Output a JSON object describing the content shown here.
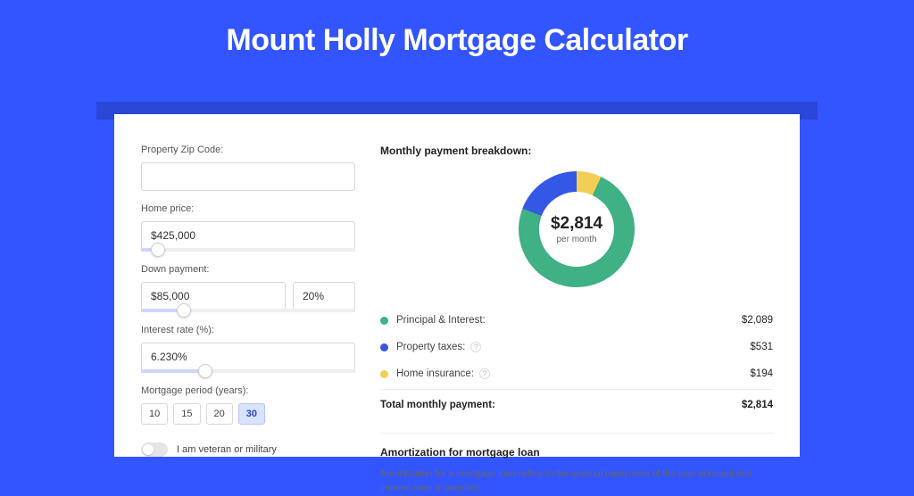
{
  "title": "Mount Holly Mortgage Calculator",
  "colors": {
    "accent": "#3355ff",
    "green": "#3fb185",
    "blue": "#3557e5",
    "yellow": "#f2cf54"
  },
  "inputs": {
    "zip": {
      "label": "Property Zip Code:",
      "value": ""
    },
    "price": {
      "label": "Home price:",
      "value": "$425,000",
      "slider_pct": 8
    },
    "down": {
      "label": "Down payment:",
      "value": "$85,000",
      "pct": "20%",
      "slider_pct": 20
    },
    "rate": {
      "label": "Interest rate (%):",
      "value": "6.230%",
      "slider_pct": 30
    },
    "period": {
      "label": "Mortgage period (years):",
      "options": [
        "10",
        "15",
        "20",
        "30"
      ],
      "selected": "30"
    },
    "veteran": {
      "label": "I am veteran or military",
      "value": false
    }
  },
  "breakdown": {
    "title": "Monthly payment breakdown:",
    "total": "$2,814",
    "sub": "per month",
    "items": [
      {
        "label": "Principal & Interest:",
        "value": "$2,089",
        "color": "green",
        "info": false
      },
      {
        "label": "Property taxes:",
        "value": "$531",
        "color": "blue",
        "info": true
      },
      {
        "label": "Home insurance:",
        "value": "$194",
        "color": "yellow",
        "info": true
      }
    ],
    "total_row": {
      "label": "Total monthly payment:",
      "value": "$2,814"
    }
  },
  "amortization": {
    "title": "Amortization for mortgage loan",
    "text": "Amortization for a mortgage loan refers to the gradual repayment of the loan principal and interest over a specified"
  },
  "chart_data": {
    "type": "pie",
    "title": "Monthly payment breakdown",
    "categories": [
      "Principal & Interest",
      "Property taxes",
      "Home insurance"
    ],
    "values": [
      2089,
      531,
      194
    ],
    "total": 2814,
    "unit": "USD per month",
    "colors": [
      "#3fb185",
      "#3557e5",
      "#f2cf54"
    ]
  }
}
